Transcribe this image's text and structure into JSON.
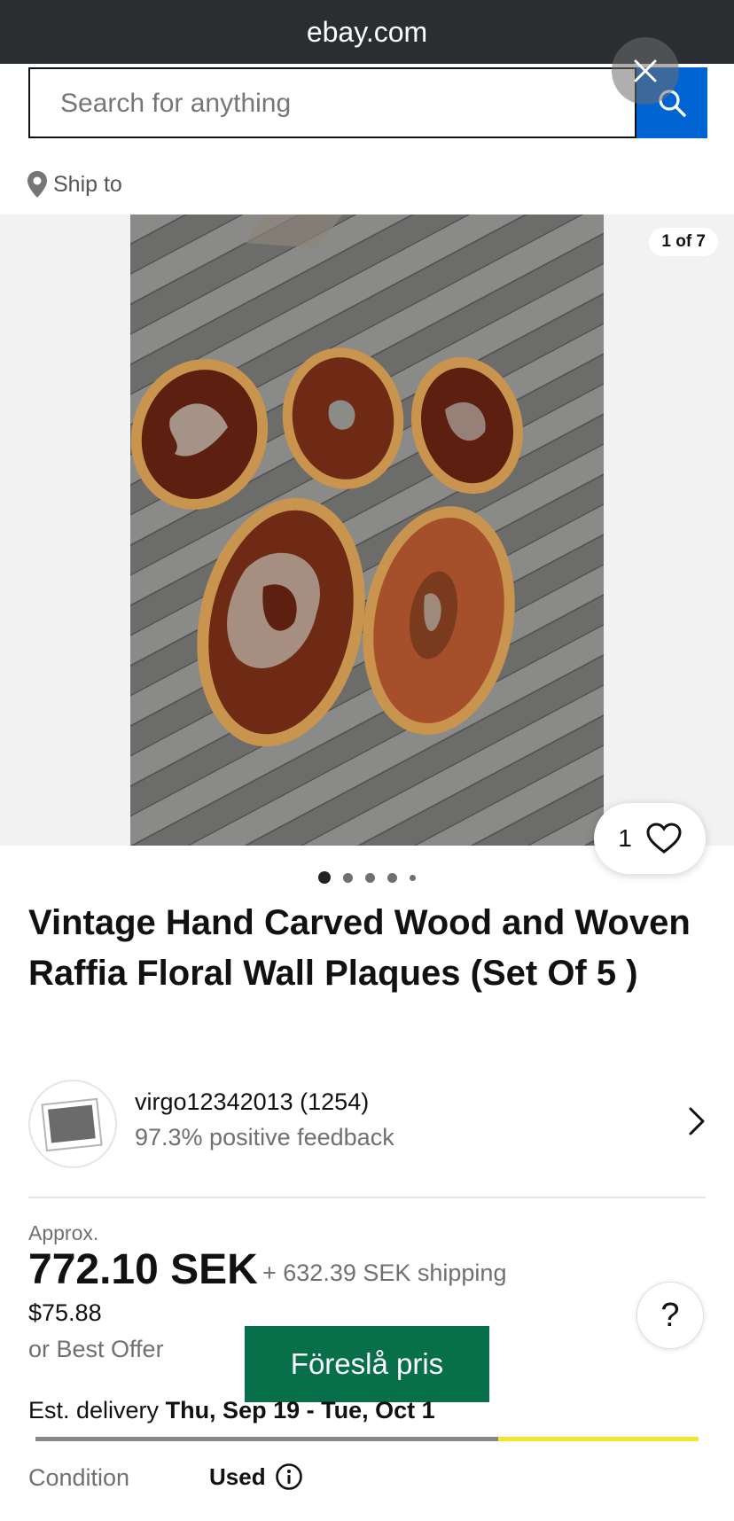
{
  "browser": {
    "url": "ebay.com"
  },
  "search": {
    "placeholder": "Search for anything"
  },
  "ship_to": {
    "label": "Ship to"
  },
  "gallery": {
    "counter": "1 of 7",
    "favorite_count": "1",
    "dot_count": 5,
    "active_dot": 0
  },
  "listing": {
    "title": "Vintage Hand Carved Wood and Woven Raffia Floral Wall Plaques (Set Of 5 )"
  },
  "seller": {
    "name": "virgo12342013 (1254)",
    "feedback": "97.3% positive feedback"
  },
  "pricing": {
    "approx_label": "Approx.",
    "price": "772.10 SEK",
    "shipping": "+ 632.39 SEK shipping",
    "usd_price": "$75.88",
    "best_offer": "or Best Offer",
    "offer_button": "Föreslå pris"
  },
  "delivery": {
    "label": "Est. delivery",
    "dates": "Thu, Sep 19 - Tue, Oct 1"
  },
  "condition": {
    "label": "Condition",
    "value": "Used"
  },
  "colors": {
    "primary_blue": "#0064d2",
    "offer_green": "#07704a",
    "topbar": "#2b2e30"
  }
}
